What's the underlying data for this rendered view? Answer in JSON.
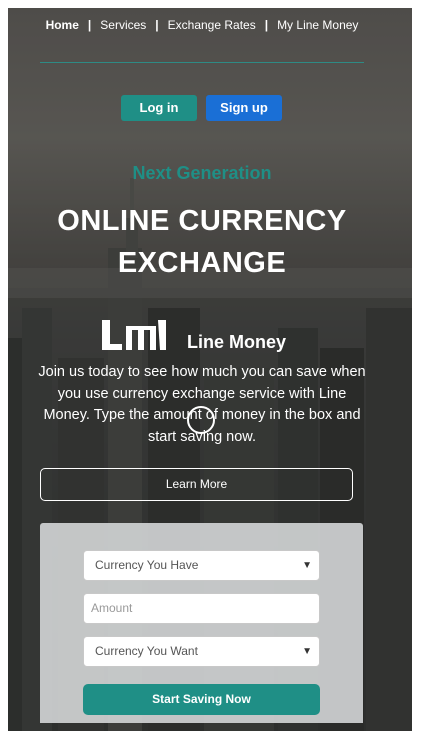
{
  "nav": {
    "home": "Home",
    "services": "Services",
    "exchange_rates": "Exchange Rates",
    "my_line_money": "My Line Money",
    "separator": "|"
  },
  "auth": {
    "login": "Log in",
    "signup": "Sign up"
  },
  "hero": {
    "tagline": "Next Generation",
    "headline_line1": "ONLINE CURRENCY",
    "headline_line2": "EXCHANGE",
    "logo_icon": "line-money-logo-icon",
    "brand": "Line Money",
    "intro": "Join us today to see how much you can save when you use currency exchange service with Line Money. Type the amount of money in the box and start saving now.",
    "learn_more": "Learn More"
  },
  "form": {
    "currency_have": "Currency You Have",
    "amount_placeholder": "Amount",
    "currency_want": "Currency You Want",
    "submit": "Start Saving Now"
  },
  "colors": {
    "teal": "#1f8f86",
    "blue": "#1a6fd6"
  }
}
